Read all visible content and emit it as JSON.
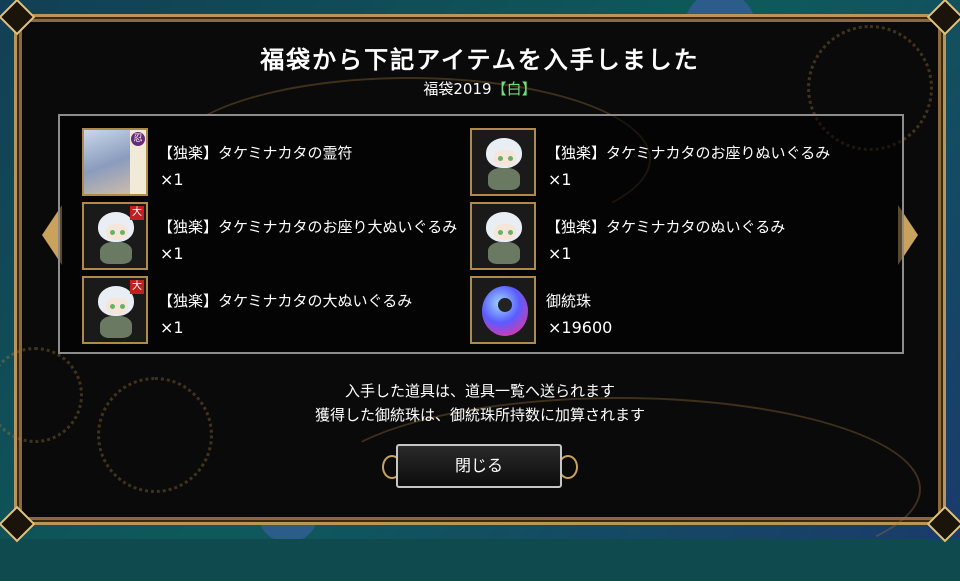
{
  "dialog": {
    "title": "福袋から下記アイテムを入手しました",
    "subtitle_prefix": "福袋2019",
    "subtitle_highlight": "【白】",
    "accent_color": "#6fe07a"
  },
  "items": [
    {
      "name": "【独楽】タケミナカタの霊符",
      "qty": "×1",
      "icon": "talisman-card-icon",
      "badge": "忍"
    },
    {
      "name": "【独楽】タケミナカタのお座りぬいぐるみ",
      "qty": "×1",
      "icon": "plush-doll-icon"
    },
    {
      "name": "【独楽】タケミナカタのお座り大ぬいぐるみ",
      "qty": "×1",
      "icon": "plush-doll-large-icon",
      "badge": "大"
    },
    {
      "name": "【独楽】タケミナカタのぬいぐるみ",
      "qty": "×1",
      "icon": "plush-doll-icon"
    },
    {
      "name": "【独楽】タケミナカタの大ぬいぐるみ",
      "qty": "×1",
      "icon": "plush-doll-large-icon",
      "badge": "大"
    },
    {
      "name": "御統珠",
      "qty": "×19600",
      "icon": "magatama-orb-icon"
    }
  ],
  "info": {
    "line1": "入手した道具は、道具一覧へ送られます",
    "line2": "獲得した御統珠は、御統珠所持数に加算されます"
  },
  "close_button": {
    "label": "閉じる"
  }
}
